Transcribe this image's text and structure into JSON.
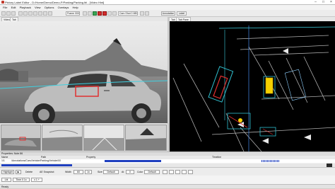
{
  "window": {
    "title": "Pictory Label Editor - D:/Home/Demo/Demo-P/Parking/Parking.lbl - [Video Hint]",
    "controls": [
      "–",
      "□",
      "×"
    ]
  },
  "menu": [
    "File",
    "Edit",
    "Playback",
    "View",
    "Options",
    "Overlays",
    "Help"
  ],
  "toolbar": {
    "frame_select": "Frame 0000",
    "source_select": "Cam Shot 0 MB",
    "tab_annotation": "Annotation",
    "tab_label": "Label"
  },
  "left_tabs": [
    "Video",
    "Tab"
  ],
  "right_tabs": [
    "Tab",
    "Tab Pane"
  ],
  "props": {
    "header_title": "Properties: Note 86",
    "columns": [
      "Name",
      "Path",
      "Property",
      "Timeline"
    ],
    "row_name": "1/1",
    "row_path": "/Annotations/Cars/Vehicle/Parking/Vehicle/00",
    "row_property": "",
    "timeline_progress": 0.73
  },
  "controls": {
    "btn_highlight": "Highlight",
    "btn_b": "▶",
    "label_d": "Delete",
    "label_ae_snapshot": "AE Snapshot",
    "label_width": "Width",
    "width_value": "60",
    "speed_value": "1x",
    "label_size": "Size",
    "size_value": "Default",
    "label_at": "At",
    "at_value": "0",
    "label_color": "Color",
    "color_value": "Default",
    "icon_names": [
      "pen-icon",
      "eraser-icon",
      "copy-icon",
      "trash-icon",
      "lock-icon"
    ]
  },
  "lower": {
    "labels": [
      "Lbl",
      "Time 0 1x",
      "x 1 +"
    ]
  },
  "status": {
    "text": "Ready"
  },
  "colors": {
    "accent": "#1f3fbf",
    "bbox_red": "#e03030",
    "horizon_cyan": "#3fd0e0",
    "lidar_points": "#d0d0d0"
  }
}
